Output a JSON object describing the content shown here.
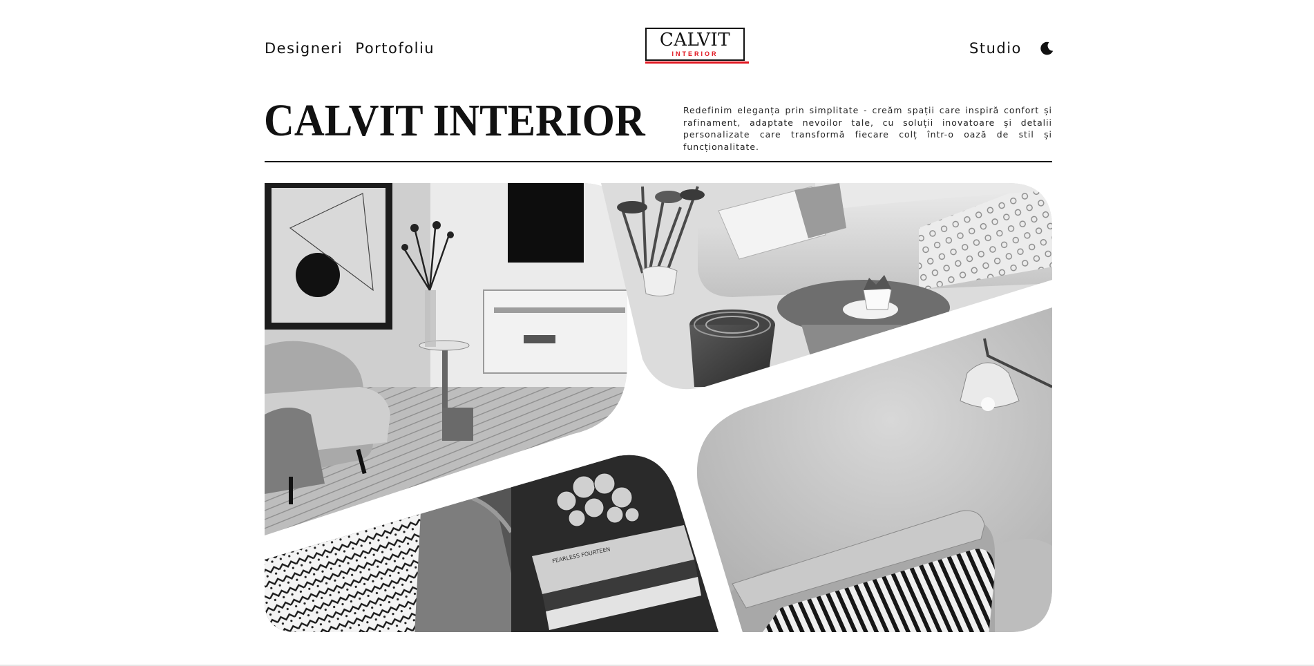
{
  "header": {
    "nav_left": [
      "Designeri",
      "Portofoliu"
    ],
    "nav_right": [
      "Studio"
    ],
    "theme_toggle_icon": "moon-icon",
    "logo": {
      "main": "CALVIT",
      "sub": "INTERIOR",
      "accent_color": "#e0141e"
    }
  },
  "hero": {
    "title": "CALVIT INTERIOR",
    "description": "Redefinim eleganța prin simplitate - creăm spații care inspiră confort și rafinament, adaptate nevoilor tale, cu soluții inovatoare și detalii personalizate care transformă fiecare colț într-o oază de stil și funcționalitate."
  },
  "gallery": {
    "images": [
      {
        "name": "living-room-armchair-photo"
      },
      {
        "name": "sofa-coffee-table-photo"
      },
      {
        "name": "books-coral-decor-photo"
      },
      {
        "name": "sofa-lamp-wall-photo"
      }
    ]
  }
}
